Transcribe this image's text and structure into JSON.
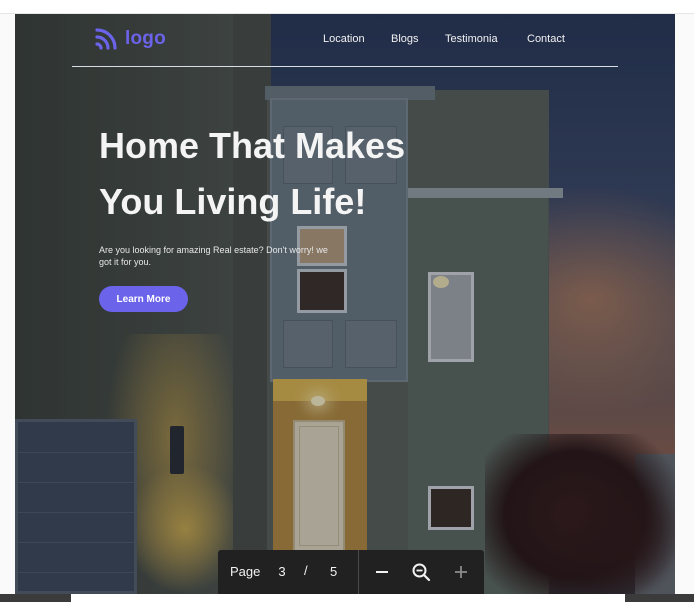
{
  "pdf_viewer": {
    "toolbar": {
      "page_label": "Page",
      "current_page": "3",
      "separator": "/",
      "total_pages": "5",
      "icons": [
        "minus-icon",
        "zoom-icon",
        "plus-icon"
      ]
    }
  },
  "slide": {
    "logo": {
      "text": "logo",
      "icon": "rss-signal-icon",
      "color": "#6b63ea"
    },
    "nav": {
      "links": [
        "Location",
        "Blogs",
        "Testimonia",
        "Contact"
      ]
    },
    "hero": {
      "title_line1": "Home That Makes",
      "title_line2": "You Living Life!",
      "subtitle": "Are you looking for amazing Real estate? Don't worry! we got it for you.",
      "cta_label": "Learn More",
      "accent_color": "#6b63ea"
    }
  }
}
